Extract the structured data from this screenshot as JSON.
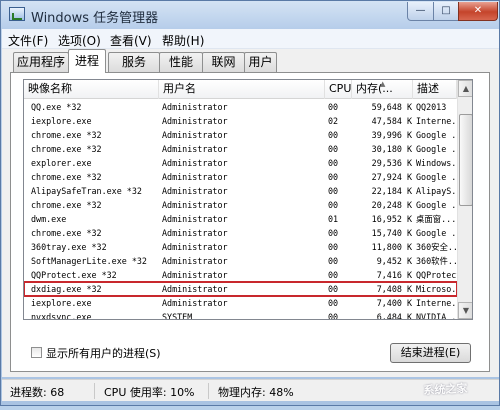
{
  "window": {
    "title": "Windows 任务管理器",
    "controls": {
      "minimize": "—",
      "maximize": "□",
      "close": "✕"
    }
  },
  "menu": [
    {
      "label": "文件(F)"
    },
    {
      "label": "选项(O)"
    },
    {
      "label": "查看(V)"
    },
    {
      "label": "帮助(H)"
    }
  ],
  "tabs": [
    {
      "label": "应用程序"
    },
    {
      "label": "进程",
      "active": true
    },
    {
      "label": "服务"
    },
    {
      "label": "性能"
    },
    {
      "label": "联网"
    },
    {
      "label": "用户"
    }
  ],
  "table": {
    "columns": [
      "映像名称",
      "用户名",
      "CPU",
      "内存(...",
      "描述"
    ],
    "rows": [
      [
        "QQ.exe *32",
        "Administrator",
        "00",
        "59,648 K",
        "QQ2013"
      ],
      [
        "iexplore.exe",
        "Administrator",
        "02",
        "47,584 K",
        "Interne..."
      ],
      [
        "chrome.exe *32",
        "Administrator",
        "00",
        "39,996 K",
        "Google ..."
      ],
      [
        "chrome.exe *32",
        "Administrator",
        "00",
        "30,180 K",
        "Google ..."
      ],
      [
        "explorer.exe",
        "Administrator",
        "00",
        "29,536 K",
        "Windows..."
      ],
      [
        "chrome.exe *32",
        "Administrator",
        "00",
        "27,924 K",
        "Google ..."
      ],
      [
        "AlipaySafeTran.exe *32",
        "Administrator",
        "00",
        "22,184 K",
        "AlipayS..."
      ],
      [
        "chrome.exe *32",
        "Administrator",
        "00",
        "20,248 K",
        "Google ..."
      ],
      [
        "dwm.exe",
        "Administrator",
        "01",
        "16,952 K",
        "桌面窗..."
      ],
      [
        "chrome.exe *32",
        "Administrator",
        "00",
        "15,740 K",
        "Google ..."
      ],
      [
        "360tray.exe *32",
        "Administrator",
        "00",
        "11,800 K",
        "360安全..."
      ],
      [
        "SoftManagerLite.exe *32",
        "Administrator",
        "00",
        "9,452 K",
        "360软件..."
      ],
      [
        "QQProtect.exe *32",
        "Administrator",
        "00",
        "7,416 K",
        "QQProtect"
      ],
      [
        "dxdiag.exe *32",
        "Administrator",
        "00",
        "7,408 K",
        "Microso..."
      ],
      [
        "iexplore.exe",
        "Administrator",
        "00",
        "7,400 K",
        "Interne..."
      ],
      [
        "nvxdsync.exe",
        "SYSTEM",
        "00",
        "6,484 K",
        "NVIDIA ..."
      ]
    ],
    "highlighted_row": 13,
    "highlight_color": "#c8282d"
  },
  "show_all_users": "显示所有用户的进程(S)",
  "end_process": "结束进程(E)",
  "status": {
    "processes": "进程数: 68",
    "cpu": "CPU 使用率: 10%",
    "memory": "物理内存: 48%"
  },
  "watermark": "系统之家"
}
